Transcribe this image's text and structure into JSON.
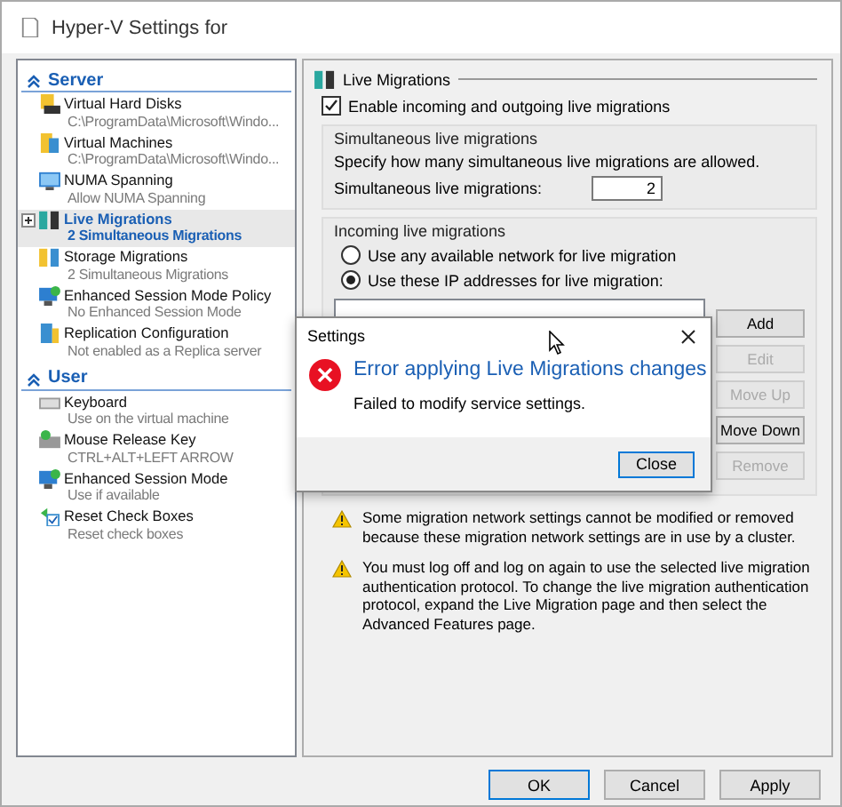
{
  "window": {
    "title": "Hyper-V Settings for"
  },
  "sidebar": {
    "sections": [
      {
        "label": "Server",
        "expanded": true,
        "items": [
          {
            "name": "Virtual Hard Disks",
            "detail": "C:\\ProgramData\\Microsoft\\Windo...",
            "expandable": false,
            "selected": false
          },
          {
            "name": "Virtual Machines",
            "detail": "C:\\ProgramData\\Microsoft\\Windo...",
            "expandable": false,
            "selected": false
          },
          {
            "name": "NUMA Spanning",
            "detail": "Allow NUMA Spanning",
            "expandable": false,
            "selected": false
          },
          {
            "name": "Live Migrations",
            "detail": "2 Simultaneous Migrations",
            "expandable": true,
            "selected": true
          },
          {
            "name": "Storage Migrations",
            "detail": "2 Simultaneous Migrations",
            "expandable": false,
            "selected": false
          },
          {
            "name": "Enhanced Session Mode Policy",
            "detail": "No Enhanced Session Mode",
            "expandable": false,
            "selected": false
          },
          {
            "name": "Replication Configuration",
            "detail": "Not enabled as a Replica server",
            "expandable": false,
            "selected": false
          }
        ]
      },
      {
        "label": "User",
        "expanded": true,
        "items": [
          {
            "name": "Keyboard",
            "detail": "Use on the virtual machine",
            "expandable": false,
            "selected": false
          },
          {
            "name": "Mouse Release Key",
            "detail": "CTRL+ALT+LEFT ARROW",
            "expandable": false,
            "selected": false
          },
          {
            "name": "Enhanced Session Mode",
            "detail": "Use if available",
            "expandable": false,
            "selected": false
          },
          {
            "name": "Reset Check Boxes",
            "detail": "Reset check boxes",
            "expandable": false,
            "selected": false
          }
        ]
      }
    ]
  },
  "page": {
    "title": "Live Migrations",
    "enable": {
      "label": "Enable incoming and outgoing live migrations",
      "checked": true
    },
    "simultaneous": {
      "title": "Simultaneous live migrations",
      "description": "Specify how many simultaneous live migrations are allowed.",
      "field_label": "Simultaneous live migrations:",
      "value": "2"
    },
    "incoming": {
      "title": "Incoming live migrations",
      "options": [
        {
          "label": "Use any available network for live migration",
          "selected": false
        },
        {
          "label": "Use these IP addresses for live migration:",
          "selected": true
        }
      ],
      "buttons": [
        {
          "label": "Add",
          "disabled": false
        },
        {
          "label": "Edit",
          "disabled": true
        },
        {
          "label": "Move Up",
          "disabled": true
        },
        {
          "label": "Move Down",
          "disabled": false
        },
        {
          "label": "Remove",
          "disabled": true
        }
      ]
    },
    "warnings": [
      "Some migration network settings cannot be modified or removed because these migration network settings are in use by a cluster.",
      "You must log off and log on again to use the selected live migration authentication protocol. To change the live migration authentication protocol, expand the Live Migration page and then select the Advanced Features page."
    ]
  },
  "buttons": [
    {
      "label": "OK",
      "default": true
    },
    {
      "label": "Cancel",
      "default": false
    },
    {
      "label": "Apply",
      "default": false
    }
  ],
  "error_dialog": {
    "title": "Settings",
    "heading": "Error applying Live Migrations changes",
    "message": "Failed to modify service settings.",
    "button": "Close"
  }
}
